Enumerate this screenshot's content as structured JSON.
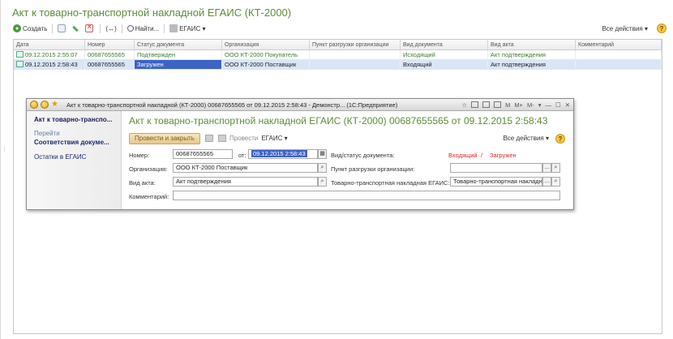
{
  "main": {
    "title": "Акт к товарно-транспортной накладной ЕГАИС (КТ-2000)",
    "toolbar": {
      "create": "Создать",
      "find": "Найти...",
      "egais": "ЕГАИС",
      "arrows": "(↔)",
      "all_actions": "Все действия",
      "help": "?"
    },
    "columns": [
      "Дата",
      "Номер",
      "Статус документа",
      "Организация",
      "Пункт разгрузки организации",
      "Вид документа",
      "Вид акта",
      "Комментарий"
    ],
    "rows": [
      [
        "09.12.2015 2:55:07",
        "00687655565",
        "Подтвержден",
        "ООО КТ-2000 Покупатель",
        "",
        "Исходящий",
        "Акт подтверждения",
        ""
      ],
      [
        "09.12.2015 2:58:43",
        "00687655565",
        "Загружен",
        "ООО КТ-2000 Поставщик",
        "",
        "Входящий",
        "Акт подтверждения",
        ""
      ]
    ]
  },
  "window": {
    "caption": "Акт к товарно-транспортной накладной (КТ-2000) 00687655565 от 09.12.2015 2:58:43 - Демонстр... (1С:Предприятие)",
    "tools": [
      "M",
      "M+",
      "M-"
    ],
    "sidebar": {
      "active": "Акт к товарно-транспо...",
      "section": "Перейти",
      "item_bold": "Соответствия докуме...",
      "item": "Остатки в ЕГАИС"
    },
    "doc_title": "Акт к товарно-транспортной накладной ЕГАИС (КТ-2000) 00687655565 от 09.12.2015 2:58:43",
    "toolbar": {
      "post_close": "Провести и закрыть",
      "post": "Провести",
      "egais": "ЕГАИС",
      "all_actions": "Все действия",
      "help": "?"
    },
    "form": {
      "number_label": "Номер:",
      "number_value": "00687655565",
      "from_label": "от:",
      "date_value": "09.12.2015  2:58:43",
      "kind_status_label": "Вид/статус документа:",
      "kind": "Входящий",
      "slash": "/",
      "status": "Загружен",
      "org_label": "Организация:",
      "org_value": "ООО КТ-2000 Поставщик",
      "unload_label": "Пункт разгрузки организации:",
      "unload_value": "",
      "act_label": "Вид акта:",
      "act_value": "Акт подтверждения",
      "ttn_label": "Товарно-транспортная накладная ЕГАИС:",
      "ttn_value": "Товарно-транспортная накладн",
      "comment_label": "Комментарий:",
      "comment_value": ""
    }
  }
}
